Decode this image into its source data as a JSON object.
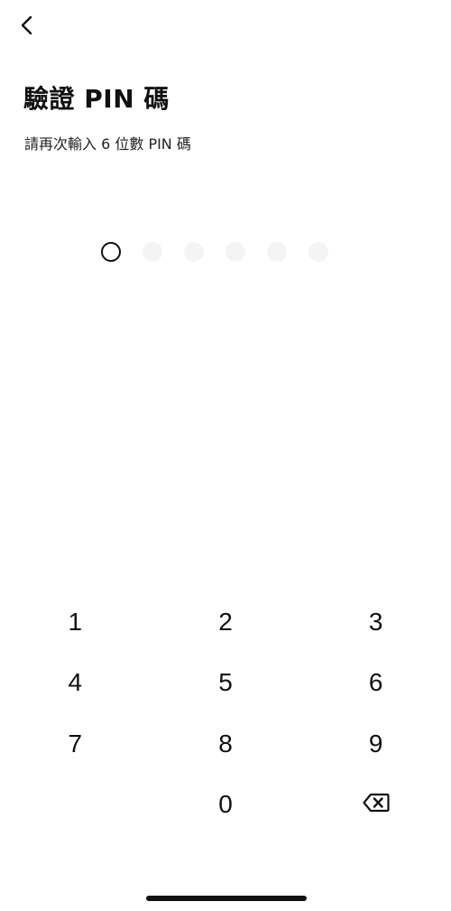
{
  "header": {
    "back_icon": "chevron-left-icon",
    "title": "驗證 PIN 碼",
    "subtitle": "請再次輸入 6 位數 PIN 碼"
  },
  "pin": {
    "length": 6,
    "entered": 0
  },
  "keypad": {
    "rows": [
      [
        "1",
        "2",
        "3"
      ],
      [
        "4",
        "5",
        "6"
      ],
      [
        "7",
        "8",
        "9"
      ],
      [
        "",
        "0",
        "backspace"
      ]
    ],
    "backspace_icon": "backspace-icon"
  },
  "colors": {
    "text": "#111111",
    "empty_dot": "#f4f4f4",
    "background": "#ffffff"
  }
}
